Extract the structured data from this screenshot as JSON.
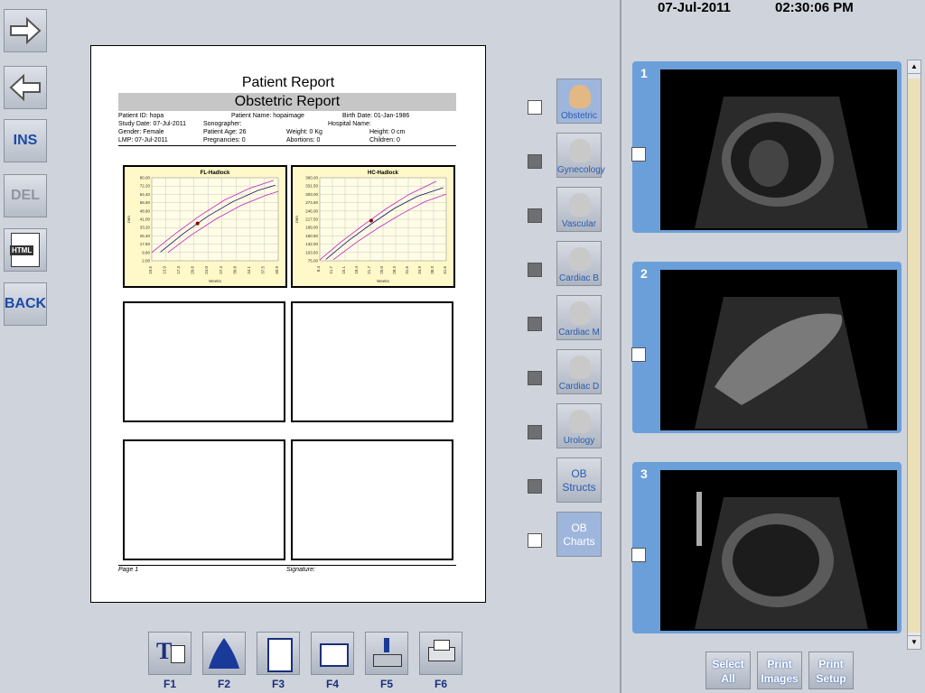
{
  "datetime": {
    "date": "07-Jul-2011",
    "time": "02:30:06 PM"
  },
  "left_toolbar": [
    {
      "name": "forward-button",
      "label": ""
    },
    {
      "name": "back-arrow-button",
      "label": ""
    },
    {
      "name": "ins-button",
      "label": "INS"
    },
    {
      "name": "del-button",
      "label": "DEL"
    },
    {
      "name": "html-button",
      "label": "HTML"
    },
    {
      "name": "back-button",
      "label": "BACK"
    }
  ],
  "report": {
    "title": "Patient Report",
    "subtitle": "Obstetric Report",
    "fields": {
      "patient_id": "Patient ID:  hopa",
      "patient_name": "Patient Name:  hopaimage",
      "birth_date": "Birth Date:  01-Jan-1986",
      "study_date": "Study Date:  07-Jul-2011",
      "sonographer": "Sonographer:",
      "hospital_name": "Hospital Name:",
      "gender": "Gender:  Female",
      "patient_age": "Patient Age:  26",
      "weight": "Weight:  0 Kg",
      "height": "Height:  0 cm",
      "lmp": "LMP:  07-Jul-2011",
      "pregnancies": "Pregnancies:  0",
      "abortions": "Abortions:  0",
      "children": "Children:  0"
    },
    "footer_page": "Page 1",
    "footer_signature": "Signature:"
  },
  "categories": [
    {
      "label": "Obstetric",
      "selected": true,
      "checked": false
    },
    {
      "label": "Gynecology",
      "selected": false,
      "checked": true
    },
    {
      "label": "Vascular",
      "selected": false,
      "checked": true
    },
    {
      "label": "Cardiac B",
      "selected": false,
      "checked": true
    },
    {
      "label": "Cardiac M",
      "selected": false,
      "checked": true
    },
    {
      "label": "Cardiac D",
      "selected": false,
      "checked": true
    },
    {
      "label": "Urology",
      "selected": false,
      "checked": true
    },
    {
      "label_line1": "OB",
      "label_line2": "Structs",
      "selected": false,
      "checked": true
    },
    {
      "label_line1": "OB",
      "label_line2": "Charts",
      "selected": true,
      "checked": false
    }
  ],
  "function_keys": [
    "F1",
    "F2",
    "F3",
    "F4",
    "F5",
    "F6"
  ],
  "thumbnails": [
    {
      "num": "1"
    },
    {
      "num": "2"
    },
    {
      "num": "3"
    }
  ],
  "right_buttons": [
    {
      "line1": "Select",
      "line2": "All"
    },
    {
      "line1": "Print",
      "line2": "Images"
    },
    {
      "line1": "Print",
      "line2": "Setup"
    }
  ],
  "chart_data": [
    {
      "type": "line",
      "title": "FL-Hadlock",
      "xlabel": "Weeks",
      "ylabel": "mm",
      "yticks": [
        "80.00",
        "72.20",
        "64.40",
        "56.60",
        "48.80",
        "41.00",
        "33.20",
        "25.40",
        "17.60",
        "9.80",
        "2.00"
      ],
      "xticks": [
        "10.5",
        "13.9",
        "17.3",
        "20.6",
        "24.0",
        "27.4",
        "30.8",
        "34.1",
        "37.5",
        "40.9"
      ],
      "ylim": [
        2,
        80
      ],
      "xlim": [
        10.5,
        40.9
      ],
      "series": [
        {
          "x": [
            12.6,
            18,
            24,
            30,
            36,
            40.2
          ],
          "values": [
            10.2,
            27.3,
            43.9,
            57.6,
            68.0,
            73.0
          ]
        },
        {
          "x": [
            10.5,
            16,
            22,
            28,
            34,
            39.8
          ],
          "values": [
            9.8,
            27.0,
            44.1,
            59.1,
            70.0,
            77.6
          ]
        },
        {
          "x": [
            14.4,
            20,
            26,
            32,
            38,
            40.9
          ],
          "values": [
            9.8,
            26.2,
            41.4,
            54.1,
            63.6,
            67.2
          ]
        }
      ],
      "marker": {
        "x": 21.5,
        "y": 37.1
      }
    },
    {
      "type": "line",
      "title": "HC-Hadlock",
      "xlabel": "Weeks",
      "ylabel": "mm",
      "yticks": [
        "360.00",
        "331.50",
        "303.00",
        "274.50",
        "246.00",
        "217.50",
        "189.00",
        "160.50",
        "132.00",
        "103.50",
        "75.00"
      ],
      "xticks": [
        "8.4",
        "11.7",
        "15.1",
        "18.4",
        "21.7",
        "25.0",
        "28.3",
        "31.6",
        "34.9",
        "38.3",
        "41.6"
      ],
      "ylim": [
        75,
        360
      ],
      "xlim": [
        8.4,
        41.6
      ],
      "series": [
        {
          "x": [
            10,
            16,
            22,
            28,
            34,
            40.8
          ],
          "values": [
            80,
            145,
            202,
            255,
            296,
            326
          ]
        },
        {
          "x": [
            8.4,
            14,
            20,
            26,
            32,
            39
          ],
          "values": [
            78,
            140,
            199,
            255,
            304,
            348
          ]
        },
        {
          "x": [
            12,
            18,
            24,
            30,
            36,
            41.6
          ],
          "values": [
            79,
            138,
            190,
            237,
            278,
            304
          ]
        }
      ],
      "marker": {
        "x": 21.9,
        "y": 213
      }
    }
  ],
  "colors": {
    "accent": "#2a5db0",
    "thumb_border": "#6b9fd9",
    "chart_bg": "#fff8c8",
    "ref_line": "#c020c0",
    "median_line": "#101060",
    "marker": "#800000"
  }
}
